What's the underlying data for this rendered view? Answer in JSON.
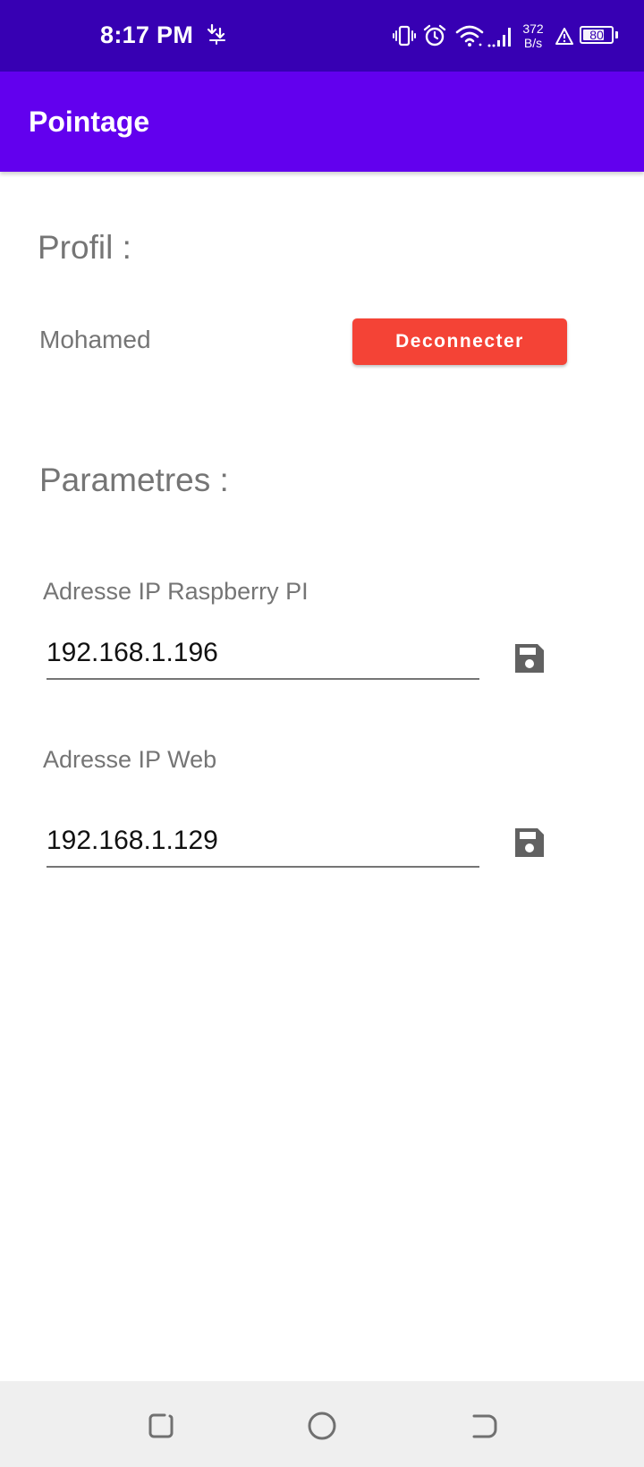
{
  "status_bar": {
    "time": "8:17 PM",
    "net_speed_value": "372",
    "net_speed_unit": "B/s",
    "battery_level": "80",
    "icons": [
      "download-icon",
      "vibrate-icon",
      "alarm-icon",
      "wifi-icon",
      "signal-icon",
      "warning-icon",
      "battery-icon"
    ]
  },
  "app_bar": {
    "title": "Pointage"
  },
  "profile": {
    "section_title": "Profil :",
    "user_name": "Mohamed",
    "disconnect_label": "Deconnecter"
  },
  "parameters": {
    "section_title": "Parametres :",
    "raspberry_ip": {
      "label": "Adresse IP Raspberry PI",
      "value": "192.168.1.196"
    },
    "web_ip": {
      "label": "Adresse IP Web",
      "value": "192.168.1.129"
    }
  },
  "colors": {
    "status_bar": "#3700b3",
    "app_bar": "#6200ee",
    "disconnect_button": "#f44336",
    "label_text": "#757575",
    "save_icon": "#616161",
    "nav_bar": "#efefef"
  },
  "nav_bar": {
    "buttons": [
      "recent-apps-icon",
      "home-icon",
      "back-icon"
    ]
  }
}
